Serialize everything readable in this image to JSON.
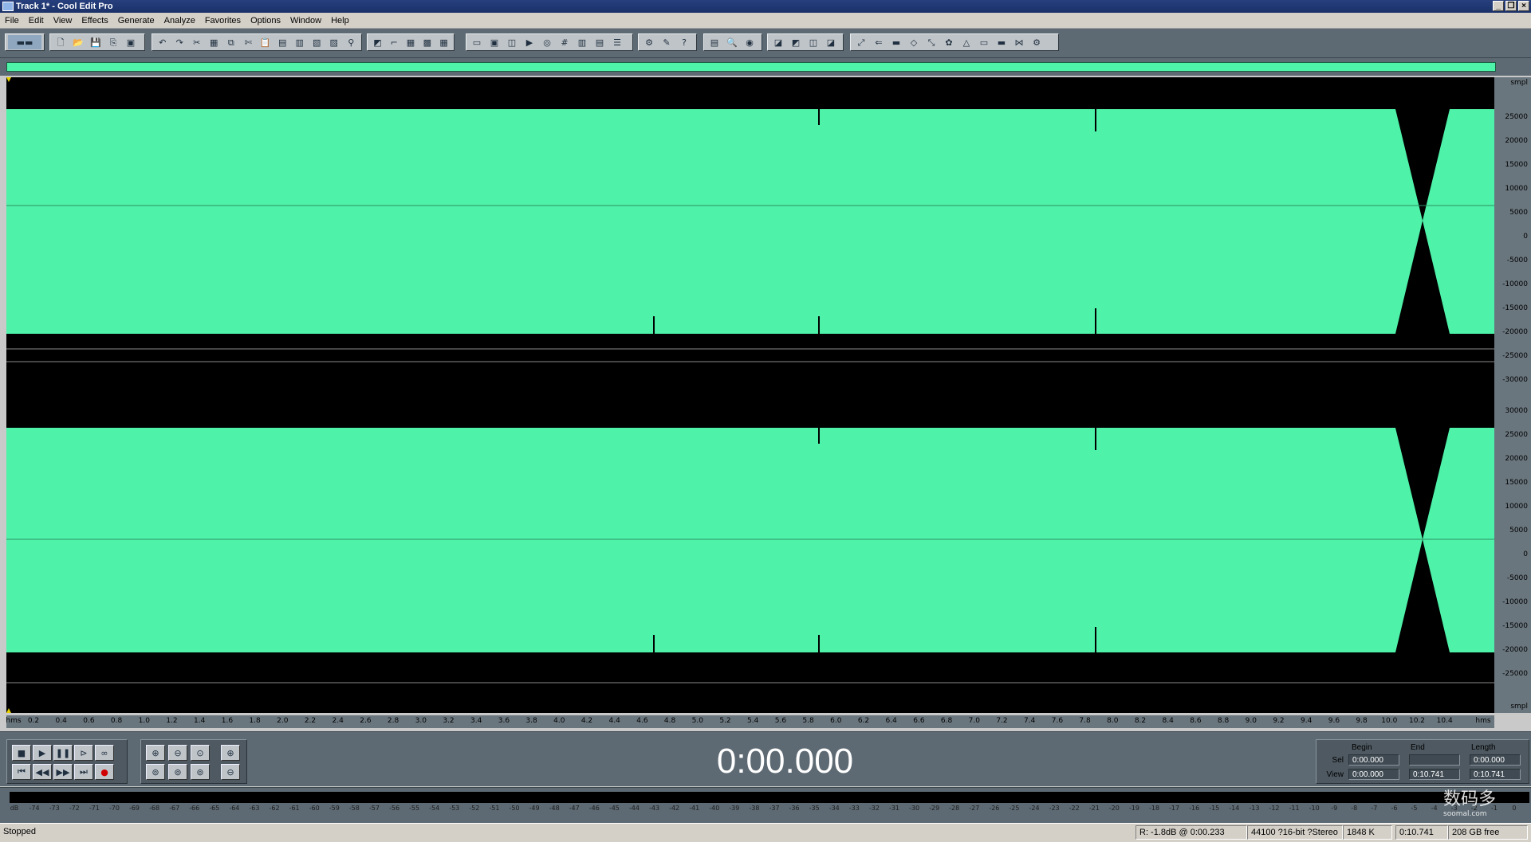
{
  "window": {
    "title": "Track 1* - Cool Edit Pro"
  },
  "menu": [
    "File",
    "Edit",
    "View",
    "Effects",
    "Generate",
    "Analyze",
    "Favorites",
    "Options",
    "Window",
    "Help"
  ],
  "toolbar_icons": [
    "waveform-multitrack-toggle",
    "new",
    "open",
    "save",
    "save-all",
    "close",
    "undo",
    "redo",
    "repeat",
    "mix-paste",
    "copy",
    "cut",
    "paste",
    "paste-new",
    "trim",
    "delete",
    "zoom-in",
    "crop",
    "envelope",
    "edit-waveform",
    "hold",
    "multitrack",
    "view",
    "tempo",
    "record-mode",
    "scrub",
    "waveform-view",
    "spectral-view",
    "marker",
    "tool",
    "mark",
    "settings",
    "cue-list",
    "play-list",
    "help",
    "info",
    "frequency-analysis",
    "phase-analysis",
    "spectrum",
    "normalize",
    "amplify",
    "fade",
    "envelope-edit",
    "stretch",
    "pitch",
    "noise-reduction",
    "reverb",
    "delay",
    "echo",
    "filter",
    "eq",
    "convert",
    "dynamics",
    "invert",
    "reverse"
  ],
  "amplitude_ruler": {
    "unit": "smpl",
    "channel1": [
      "25000",
      "20000",
      "15000",
      "10000",
      "5000",
      "0",
      "-5000",
      "-10000",
      "-15000",
      "-20000",
      "-25000",
      "-30000"
    ],
    "channel2": [
      "30000",
      "25000",
      "20000",
      "15000",
      "10000",
      "5000",
      "0",
      "-5000",
      "-10000",
      "-15000",
      "-20000",
      "-25000"
    ],
    "unit_bottom": "smpl"
  },
  "time_ruler": {
    "start_label": "hms",
    "end_label": "hms",
    "ticks": [
      "0.2",
      "0.4",
      "0.6",
      "0.8",
      "1.0",
      "1.2",
      "1.4",
      "1.6",
      "1.8",
      "2.0",
      "2.2",
      "2.4",
      "2.6",
      "2.8",
      "3.0",
      "3.2",
      "3.4",
      "3.6",
      "3.8",
      "4.0",
      "4.2",
      "4.4",
      "4.6",
      "4.8",
      "5.0",
      "5.2",
      "5.4",
      "5.6",
      "5.8",
      "6.0",
      "6.2",
      "6.4",
      "6.6",
      "6.8",
      "7.0",
      "7.2",
      "7.4",
      "7.6",
      "7.8",
      "8.0",
      "8.2",
      "8.4",
      "8.6",
      "8.8",
      "9.0",
      "9.2",
      "9.4",
      "9.6",
      "9.8",
      "10.0",
      "10.2",
      "10.4"
    ]
  },
  "transport": {
    "time_display": "0:00.000"
  },
  "selection": {
    "headers": {
      "begin": "Begin",
      "end": "End",
      "length": "Length"
    },
    "sel": {
      "label": "Sel",
      "begin": "0:00.000",
      "end": "",
      "length": "0:00.000"
    },
    "view": {
      "label": "View",
      "begin": "0:00.000",
      "end": "0:10.741",
      "length": "0:10.741"
    }
  },
  "meter": {
    "ticks": [
      "dB",
      "-74",
      "-73",
      "-72",
      "-71",
      "-70",
      "-69",
      "-68",
      "-67",
      "-66",
      "-65",
      "-64",
      "-63",
      "-62",
      "-61",
      "-60",
      "-59",
      "-58",
      "-57",
      "-56",
      "-55",
      "-54",
      "-53",
      "-52",
      "-51",
      "-50",
      "-49",
      "-48",
      "-47",
      "-46",
      "-45",
      "-44",
      "-43",
      "-42",
      "-41",
      "-40",
      "-39",
      "-38",
      "-37",
      "-36",
      "-35",
      "-34",
      "-33",
      "-32",
      "-31",
      "-30",
      "-29",
      "-28",
      "-27",
      "-26",
      "-25",
      "-24",
      "-23",
      "-22",
      "-21",
      "-20",
      "-19",
      "-18",
      "-17",
      "-16",
      "-15",
      "-14",
      "-13",
      "-12",
      "-11",
      "-10",
      "-9",
      "-8",
      "-7",
      "-6",
      "-5",
      "-4",
      "-3",
      "-2",
      "-1",
      "0"
    ]
  },
  "status": {
    "state": "Stopped",
    "peak": "R: -1.8dB @  0:00.233",
    "format": "44100 ?16-bit ?Stereo",
    "size": "1848 K",
    "duration": "0:10.741",
    "free": "208 GB free"
  },
  "watermark": {
    "text": "数码多",
    "subtext": "soomal.com"
  },
  "colors": {
    "waveform": "#4ef2a8",
    "background": "#000000",
    "panel": "#5d6a73"
  }
}
